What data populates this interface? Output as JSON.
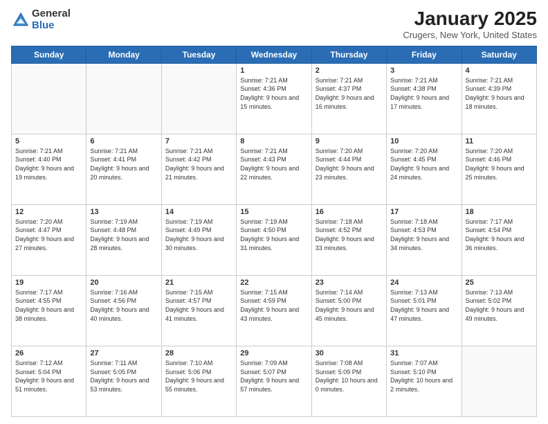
{
  "header": {
    "logo_general": "General",
    "logo_blue": "Blue",
    "month_title": "January 2025",
    "location": "Crugers, New York, United States"
  },
  "days_of_week": [
    "Sunday",
    "Monday",
    "Tuesday",
    "Wednesday",
    "Thursday",
    "Friday",
    "Saturday"
  ],
  "weeks": [
    [
      {
        "day": "",
        "empty": true
      },
      {
        "day": "",
        "empty": true
      },
      {
        "day": "",
        "empty": true
      },
      {
        "day": "1",
        "sunrise": "7:21 AM",
        "sunset": "4:36 PM",
        "daylight": "9 hours and 15 minutes."
      },
      {
        "day": "2",
        "sunrise": "7:21 AM",
        "sunset": "4:37 PM",
        "daylight": "9 hours and 16 minutes."
      },
      {
        "day": "3",
        "sunrise": "7:21 AM",
        "sunset": "4:38 PM",
        "daylight": "9 hours and 17 minutes."
      },
      {
        "day": "4",
        "sunrise": "7:21 AM",
        "sunset": "4:39 PM",
        "daylight": "9 hours and 18 minutes."
      }
    ],
    [
      {
        "day": "5",
        "sunrise": "7:21 AM",
        "sunset": "4:40 PM",
        "daylight": "9 hours and 19 minutes."
      },
      {
        "day": "6",
        "sunrise": "7:21 AM",
        "sunset": "4:41 PM",
        "daylight": "9 hours and 20 minutes."
      },
      {
        "day": "7",
        "sunrise": "7:21 AM",
        "sunset": "4:42 PM",
        "daylight": "9 hours and 21 minutes."
      },
      {
        "day": "8",
        "sunrise": "7:21 AM",
        "sunset": "4:43 PM",
        "daylight": "9 hours and 22 minutes."
      },
      {
        "day": "9",
        "sunrise": "7:20 AM",
        "sunset": "4:44 PM",
        "daylight": "9 hours and 23 minutes."
      },
      {
        "day": "10",
        "sunrise": "7:20 AM",
        "sunset": "4:45 PM",
        "daylight": "9 hours and 24 minutes."
      },
      {
        "day": "11",
        "sunrise": "7:20 AM",
        "sunset": "4:46 PM",
        "daylight": "9 hours and 25 minutes."
      }
    ],
    [
      {
        "day": "12",
        "sunrise": "7:20 AM",
        "sunset": "4:47 PM",
        "daylight": "9 hours and 27 minutes."
      },
      {
        "day": "13",
        "sunrise": "7:19 AM",
        "sunset": "4:48 PM",
        "daylight": "9 hours and 28 minutes."
      },
      {
        "day": "14",
        "sunrise": "7:19 AM",
        "sunset": "4:49 PM",
        "daylight": "9 hours and 30 minutes."
      },
      {
        "day": "15",
        "sunrise": "7:19 AM",
        "sunset": "4:50 PM",
        "daylight": "9 hours and 31 minutes."
      },
      {
        "day": "16",
        "sunrise": "7:18 AM",
        "sunset": "4:52 PM",
        "daylight": "9 hours and 33 minutes."
      },
      {
        "day": "17",
        "sunrise": "7:18 AM",
        "sunset": "4:53 PM",
        "daylight": "9 hours and 34 minutes."
      },
      {
        "day": "18",
        "sunrise": "7:17 AM",
        "sunset": "4:54 PM",
        "daylight": "9 hours and 36 minutes."
      }
    ],
    [
      {
        "day": "19",
        "sunrise": "7:17 AM",
        "sunset": "4:55 PM",
        "daylight": "9 hours and 38 minutes."
      },
      {
        "day": "20",
        "sunrise": "7:16 AM",
        "sunset": "4:56 PM",
        "daylight": "9 hours and 40 minutes."
      },
      {
        "day": "21",
        "sunrise": "7:15 AM",
        "sunset": "4:57 PM",
        "daylight": "9 hours and 41 minutes."
      },
      {
        "day": "22",
        "sunrise": "7:15 AM",
        "sunset": "4:59 PM",
        "daylight": "9 hours and 43 minutes."
      },
      {
        "day": "23",
        "sunrise": "7:14 AM",
        "sunset": "5:00 PM",
        "daylight": "9 hours and 45 minutes."
      },
      {
        "day": "24",
        "sunrise": "7:13 AM",
        "sunset": "5:01 PM",
        "daylight": "9 hours and 47 minutes."
      },
      {
        "day": "25",
        "sunrise": "7:13 AM",
        "sunset": "5:02 PM",
        "daylight": "9 hours and 49 minutes."
      }
    ],
    [
      {
        "day": "26",
        "sunrise": "7:12 AM",
        "sunset": "5:04 PM",
        "daylight": "9 hours and 51 minutes."
      },
      {
        "day": "27",
        "sunrise": "7:11 AM",
        "sunset": "5:05 PM",
        "daylight": "9 hours and 53 minutes."
      },
      {
        "day": "28",
        "sunrise": "7:10 AM",
        "sunset": "5:06 PM",
        "daylight": "9 hours and 55 minutes."
      },
      {
        "day": "29",
        "sunrise": "7:09 AM",
        "sunset": "5:07 PM",
        "daylight": "9 hours and 57 minutes."
      },
      {
        "day": "30",
        "sunrise": "7:08 AM",
        "sunset": "5:09 PM",
        "daylight": "10 hours and 0 minutes."
      },
      {
        "day": "31",
        "sunrise": "7:07 AM",
        "sunset": "5:10 PM",
        "daylight": "10 hours and 2 minutes."
      },
      {
        "day": "",
        "empty": true
      }
    ]
  ]
}
